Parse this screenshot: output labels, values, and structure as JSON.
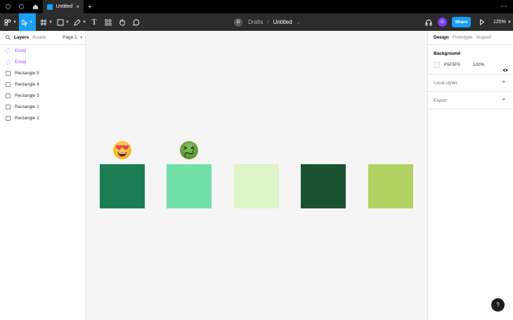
{
  "tabbar": {
    "tab_title": "Untitled",
    "close_glyph": "×",
    "new_tab_glyph": "+",
    "more_glyph": "⋯"
  },
  "toolbar": {
    "tools": [
      "main-menu",
      "move",
      "frame",
      "shape",
      "pen",
      "text",
      "resources",
      "hand",
      "comment"
    ],
    "text_tool_glyph": "T",
    "breadcrumb": {
      "avatar": "D",
      "project": "Drafts",
      "separator": "/",
      "file": "Untitled",
      "caret": "⌄"
    },
    "user_initial": "D",
    "share_label": "Share",
    "zoom_label": "125%"
  },
  "left_panel": {
    "tabs": {
      "layers": "Layers",
      "assets": "Assets"
    },
    "page": "Page 1",
    "layers": [
      {
        "name": "Emoji",
        "kind": "component"
      },
      {
        "name": "Emoji",
        "kind": "component"
      },
      {
        "name": "Rectangle 5",
        "kind": "rect"
      },
      {
        "name": "Rectangle 4",
        "kind": "rect"
      },
      {
        "name": "Rectangle 3",
        "kind": "rect"
      },
      {
        "name": "Rectangle 2",
        "kind": "rect"
      },
      {
        "name": "Rectangle 1",
        "kind": "rect"
      }
    ]
  },
  "canvas": {
    "swatches": [
      "#1c7d55",
      "#72e0a8",
      "#dcf4c6",
      "#1a5232",
      "#b2d163"
    ],
    "emojis": [
      "heart-eyes-emoji",
      "nauseated-emoji"
    ]
  },
  "right_panel": {
    "tabs": {
      "design": "Design",
      "prototype": "Prototype",
      "inspect": "Inspect"
    },
    "background": {
      "heading": "Background",
      "hex": "F5F5F5",
      "opacity": "100%"
    },
    "local_styles": "Local styles",
    "export": "Export",
    "plus_glyph": "+"
  },
  "help": {
    "label": "?"
  },
  "colors": {
    "accent": "#18a0fb",
    "user_avatar": "#7b3ff2",
    "component_purple": "#9747ff"
  }
}
